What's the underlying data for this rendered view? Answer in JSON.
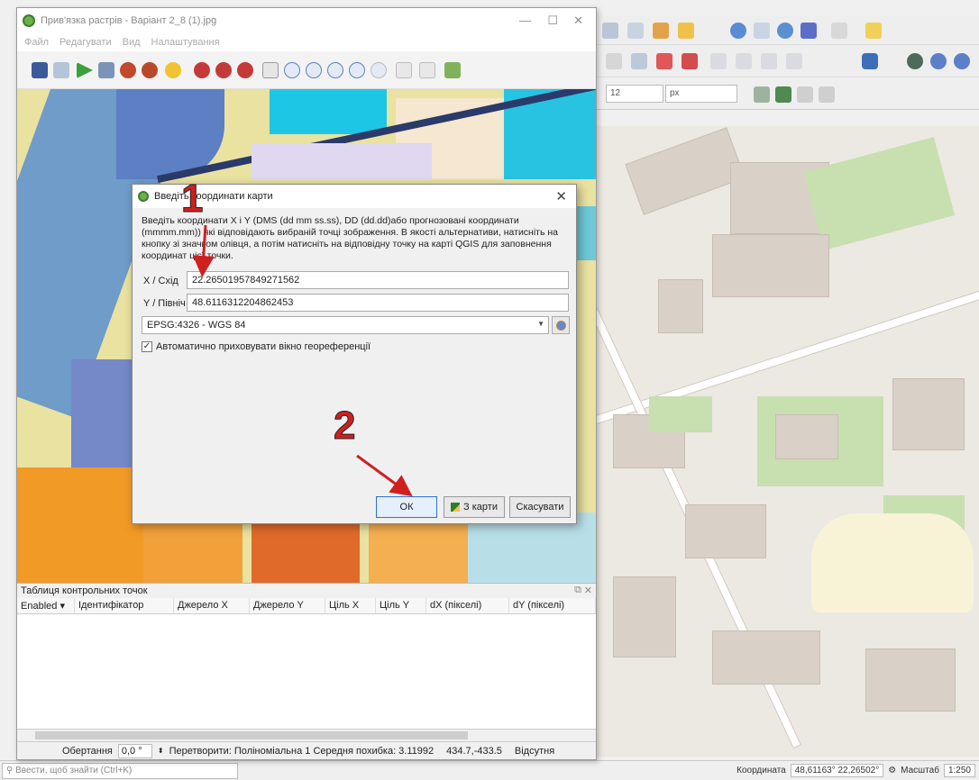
{
  "georeferencer": {
    "title": "Прив'язка растрів - Варіант 2_8 (1).jpg",
    "menu": [
      "Файл",
      "Редагувати",
      "Вид",
      "Налаштування"
    ],
    "gcp_panel": {
      "title": "Таблиця контрольних точок",
      "columns": [
        "Enabled",
        "Ідентифікатор",
        "Джерело X",
        "Джерело Y",
        "Ціль X",
        "Ціль Y",
        "dX (пікселі)",
        "dY (пікселі)"
      ]
    },
    "status": {
      "rotation_label": "Обертання",
      "rotation_value": "0,0 °",
      "transform_text": "Перетворити: Поліноміальна 1 Середня похибка: 3.11992",
      "coords_text": "434.7,-433.5",
      "missing_text": "Відсутня"
    }
  },
  "dialog": {
    "title": "Введіть координати карти",
    "description": "Введіть координати X і Y (DMS (dd mm ss.ss), DD (dd.dd)або прогнозовані координати (mmmm.mm)) які відповідають вибраній точці зображення. В якості альтернативи, натисніть на кнопку зі значком олівця, а потім натисніть на відповідну точку на карті QGIS для заповнення координат цієї точки.",
    "x_label": "X / Схід",
    "x_value": "22.26501957849271562",
    "y_label": "Y / Північ",
    "y_value": "48.6116312204862453",
    "crs_value": "EPSG:4326 - WGS 84",
    "auto_hide_label": "Автоматично приховувати вікно геореференції",
    "auto_hide_checked": "✓",
    "ok_label": "ОК",
    "from_map_label": "З карти",
    "cancel_label": "Скасувати"
  },
  "annotations": {
    "step1": "1",
    "step2": "2",
    "color": "#d01f1f"
  },
  "main": {
    "font_size_value": "12",
    "unit_value": "px",
    "locator_placeholder": "Ввести, щоб знайти (Ctrl+K)",
    "coordinate_label": "Координата",
    "coordinate_value": "48,61163° 22,26502°",
    "scale_label": "Масштаб",
    "scale_value": "1:250"
  }
}
